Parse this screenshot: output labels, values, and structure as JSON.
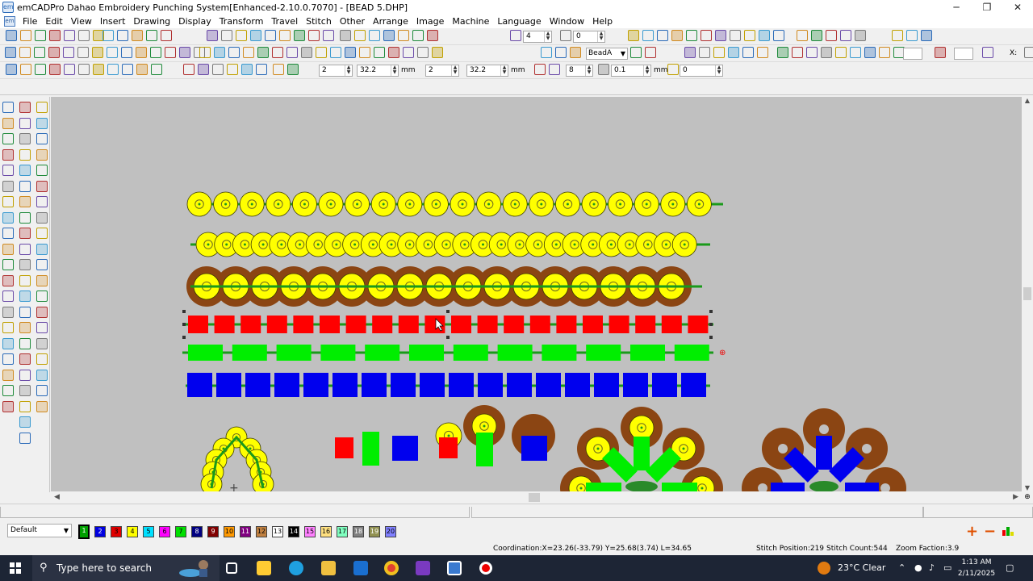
{
  "window": {
    "title": "emCADPro Dahao Embroidery Punching System[Enhanced-2.10.0.7070] - [BEAD 5.DHP]",
    "minimize": "─",
    "maximize": "❐",
    "close": "✕"
  },
  "menu": [
    "File",
    "Edit",
    "View",
    "Insert",
    "Drawing",
    "Display",
    "Transform",
    "Travel",
    "Stitch",
    "Other",
    "Arrange",
    "Image",
    "Machine",
    "Language",
    "Window",
    "Help"
  ],
  "toolbar1": {
    "field_a": "4",
    "field_b": "0"
  },
  "toolbar2": {
    "bead_select": "BeadA",
    "x_label": "X:"
  },
  "toolbar3": {
    "f1": "2",
    "f2": "32.2",
    "unit1": "mm",
    "f3": "2",
    "f4": "32.2",
    "unit2": "mm",
    "f5": "8",
    "f6": "0.1",
    "unit3": "mm",
    "f7": "0"
  },
  "palette": {
    "scheme": "Default",
    "swatches": [
      {
        "n": "1",
        "color": "#00a000"
      },
      {
        "n": "2",
        "color": "#0000e0"
      },
      {
        "n": "3",
        "color": "#e00000"
      },
      {
        "n": "4",
        "color": "#ffff00"
      },
      {
        "n": "5",
        "color": "#00e0ff"
      },
      {
        "n": "6",
        "color": "#ff00ff"
      },
      {
        "n": "7",
        "color": "#00e000"
      },
      {
        "n": "8",
        "color": "#000080"
      },
      {
        "n": "9",
        "color": "#800000"
      },
      {
        "n": "10",
        "color": "#ff9900"
      },
      {
        "n": "11",
        "color": "#800080"
      },
      {
        "n": "12",
        "color": "#c08040"
      },
      {
        "n": "13",
        "color": "#ffffff"
      },
      {
        "n": "14",
        "color": "#000000"
      },
      {
        "n": "15",
        "color": "#ff80ff"
      },
      {
        "n": "16",
        "color": "#ffe080"
      },
      {
        "n": "17",
        "color": "#80ffc0"
      },
      {
        "n": "18",
        "color": "#808080"
      },
      {
        "n": "19",
        "color": "#909050"
      },
      {
        "n": "20",
        "color": "#8080ff"
      }
    ]
  },
  "status": {
    "coordination": "Coordination:X=23.26(-33.79) Y=25.68(3.74) L=34.65",
    "stitch_position": "Stitch Position:219",
    "stitch_count": "Stitch Count:544",
    "zoom": "Zoom Faction:3.9"
  },
  "taskbar": {
    "search_placeholder": "Type here to search",
    "weather": "23°C  Clear",
    "time": "1:13 AM",
    "date": "2/11/2025"
  },
  "colors": {
    "canvas": "#c0c0c0",
    "bead_yellow": "#ffff00",
    "bead_brown": "#8b4513",
    "bead_red": "#ff0000",
    "bead_green": "#00ee00",
    "bead_blue": "#0000ee",
    "thread_green": "#1a9a1a"
  }
}
